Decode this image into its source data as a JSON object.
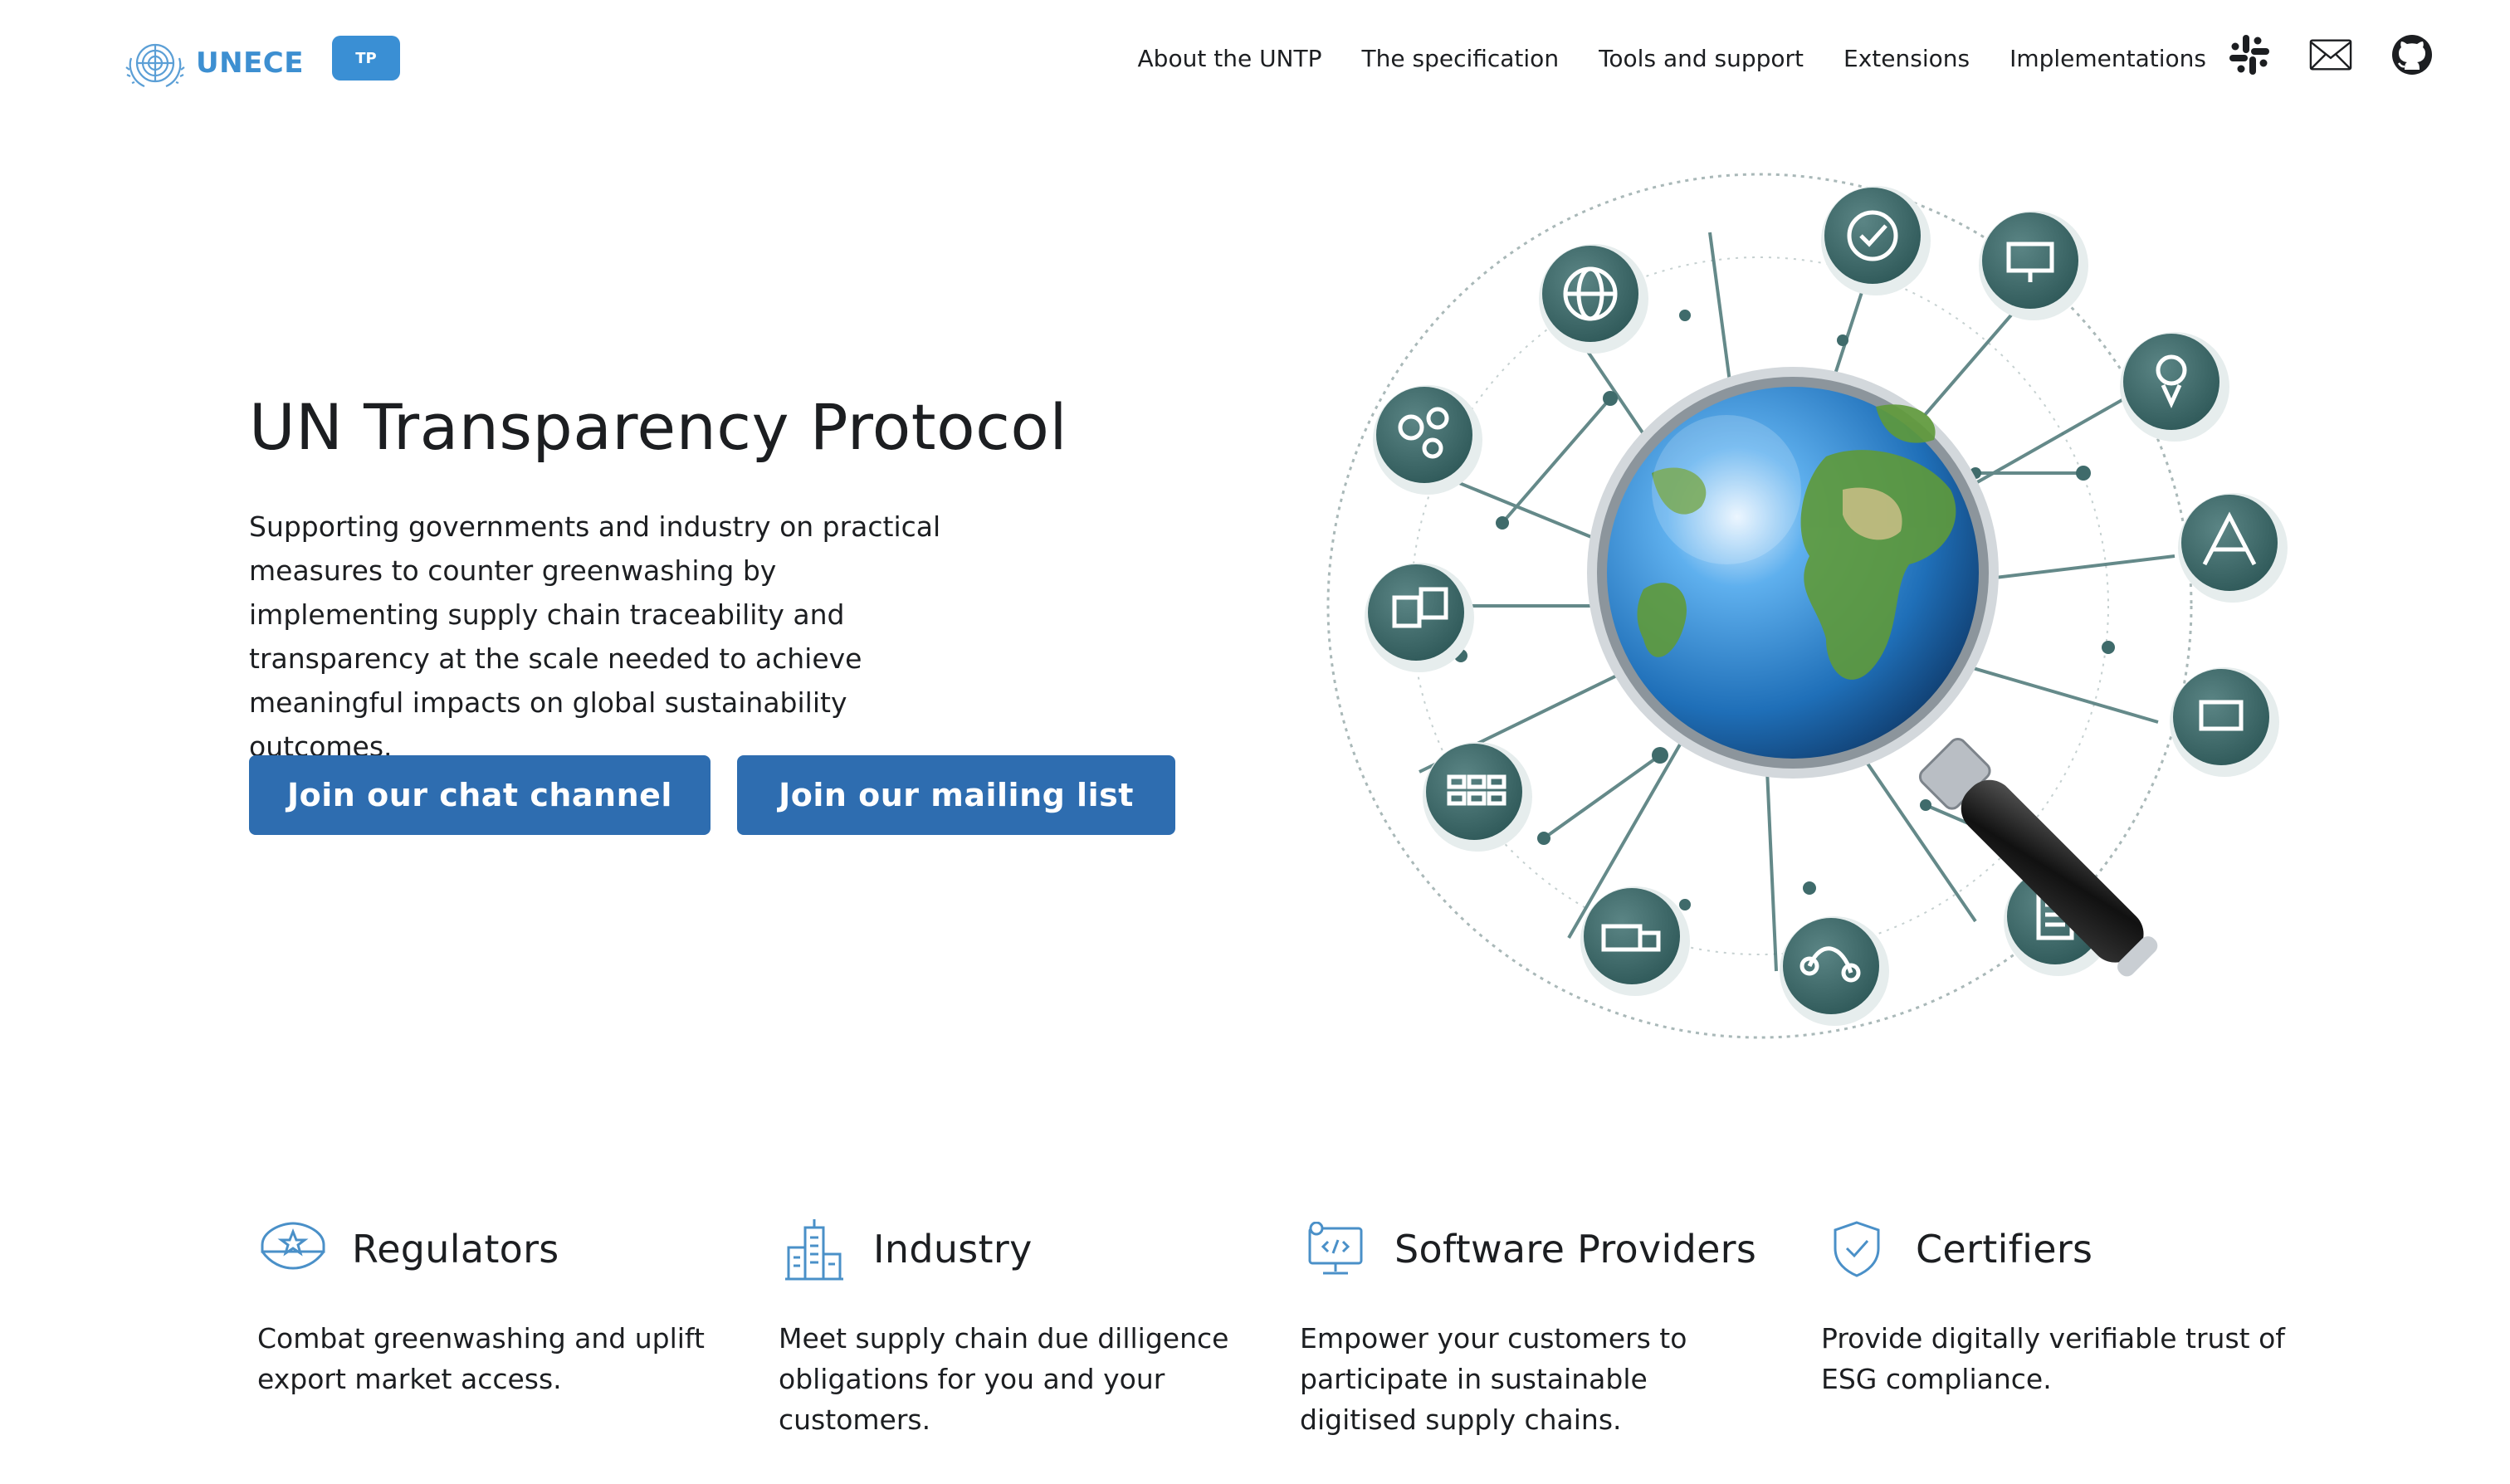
{
  "navbar": {
    "brand_text": "UNECE",
    "badge": "TP",
    "links": [
      {
        "label": "About the UNTP"
      },
      {
        "label": "The specification"
      },
      {
        "label": "Tools and support"
      },
      {
        "label": "Extensions"
      },
      {
        "label": "Implementations"
      }
    ],
    "icons": [
      "slack-icon",
      "mail-icon",
      "github-icon"
    ]
  },
  "hero": {
    "title": "UN Transparency Protocol",
    "subtitle": "Supporting governments and industry on practical measures to counter greenwashing by implementing supply chain traceability and transparency at the scale needed to achieve meaningful impacts on global sustainability outcomes.",
    "buttons": {
      "chat": "Join our chat channel",
      "mailing": "Join our mailing list"
    },
    "image": "globe-under-magnifying-glass-network-illustration"
  },
  "features": [
    {
      "icon": "police-cap-icon",
      "title": "Regulators",
      "text": "Combat greenwashing and uplift export market access."
    },
    {
      "icon": "factory-building-icon",
      "title": "Industry",
      "text": "Meet supply chain due dilligence obligations for you and your customers."
    },
    {
      "icon": "code-monitor-icon",
      "title": "Software Providers",
      "text": "Empower your customers to participate in sustainable digitised supply chains."
    },
    {
      "icon": "shield-check-icon",
      "title": "Certifiers",
      "text": "Provide digitally verifiable trust of ESG compliance."
    }
  ],
  "colors": {
    "accent": "#2e6db0",
    "brand": "#3d8fd1",
    "icon_teal": "#3d6a6a",
    "feature_icon": "#4a90c8"
  }
}
